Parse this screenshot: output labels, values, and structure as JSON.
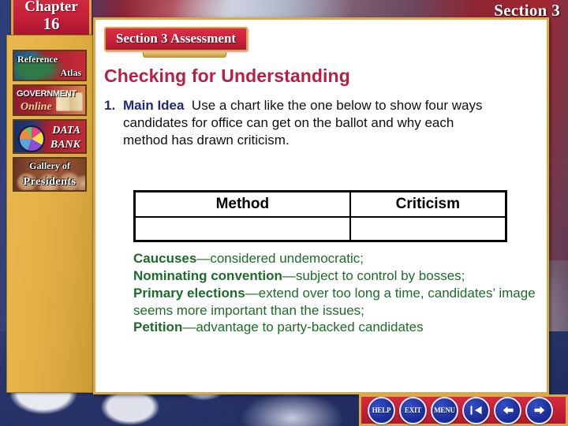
{
  "background": {
    "image_name": "us-flag-backdrop",
    "section_label": "Section 3"
  },
  "chapter_badge": {
    "word": "Chapter",
    "number": "16"
  },
  "sidebar": {
    "buttons": [
      {
        "id": "reference-atlas",
        "line1": "Reference",
        "line2": "Atlas",
        "icon": "globe-map-icon"
      },
      {
        "id": "government-online",
        "line1": "GOVERNMENT",
        "line2": "Online",
        "icon": "open-book-icon"
      },
      {
        "id": "data-bank",
        "line1": "DATA",
        "line2": "BANK",
        "icon": "pie-chart-icon"
      },
      {
        "id": "gallery-of-presidents",
        "line1": "Gallery of",
        "line2": "Presidents",
        "icon": "presidents-portraits-icon"
      }
    ]
  },
  "content": {
    "assessment_badge": "Section 3 Assessment",
    "heading": "Checking for Understanding",
    "question": {
      "number": "1.",
      "lead": "Main Idea",
      "body": "Use a chart like the one below to show four ways candidates for office can get on the ballot and why each method has drawn criticism."
    },
    "table": {
      "headers": [
        "Method",
        "Criticism"
      ],
      "rows": [
        [
          "",
          ""
        ]
      ]
    },
    "answer": {
      "items": [
        {
          "term": "Caucuses",
          "dash": "—",
          "text": "considered undemocratic;"
        },
        {
          "term": "Nominating convention",
          "dash": "—",
          "text": "subject to control by bosses;"
        },
        {
          "term": "Primary elections",
          "dash": "—",
          "text": "extend over too long a time, candidates’ image seems more important than the issues;"
        },
        {
          "term": "Petition",
          "dash": "—",
          "text": "advantage to party-backed candidates"
        }
      ]
    }
  },
  "navbar": {
    "buttons": [
      {
        "id": "help",
        "label": "HELP",
        "icon": "help-button"
      },
      {
        "id": "exit",
        "label": "EXIT",
        "icon": "exit-button"
      },
      {
        "id": "menu",
        "label": "MENU",
        "icon": "menu-button"
      },
      {
        "id": "first",
        "label": "",
        "icon": "first-slide-arrow-icon"
      },
      {
        "id": "previous",
        "label": "",
        "icon": "previous-slide-arrow-icon"
      },
      {
        "id": "next",
        "label": "",
        "icon": "next-slide-arrow-icon"
      }
    ]
  },
  "colors": {
    "accent_red": "#c41e3a",
    "gold": "#d9a94a",
    "heading_crimson": "#b81f42",
    "navy": "#1f2a78",
    "answer_green": "#1d6b2a"
  }
}
